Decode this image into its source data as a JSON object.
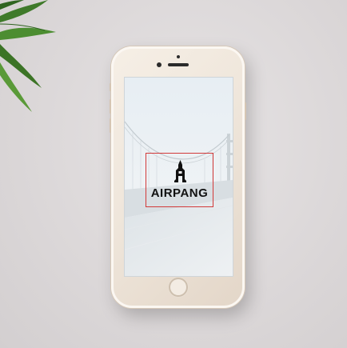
{
  "scene": {
    "background_color": "#ddd9da",
    "decoration": "plant-leaves"
  },
  "device": {
    "type": "smartphone",
    "color": "#efe6db"
  },
  "app": {
    "logo_text": "AIRPANG",
    "logo_icon": "a-letter-logo-icon",
    "logo_frame_color": "#d23a3a",
    "background_image": "foggy-suspension-bridge"
  }
}
